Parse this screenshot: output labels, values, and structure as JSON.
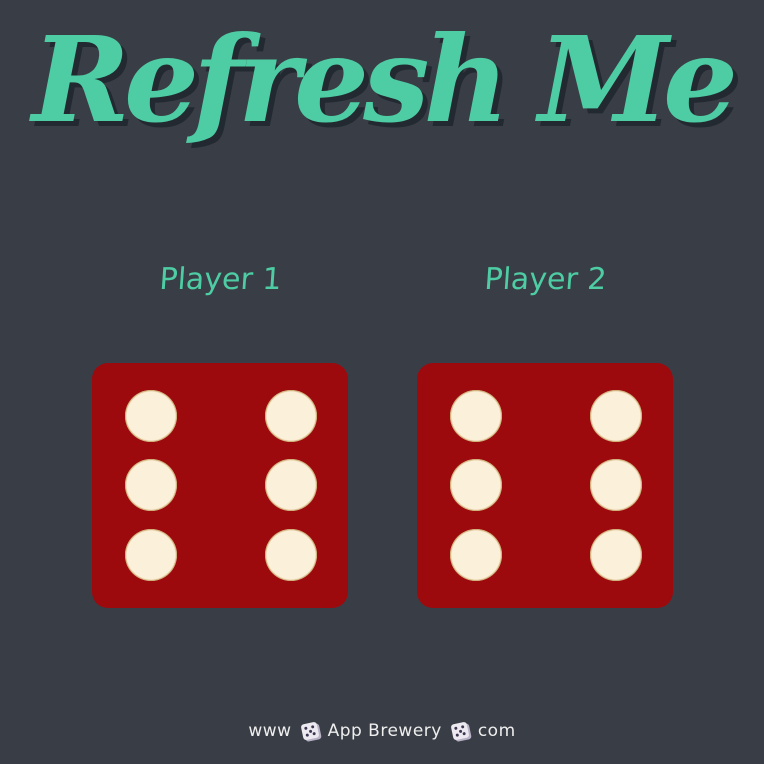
{
  "title": "Refresh Me",
  "players": [
    {
      "label": "Player 1",
      "die_value": 6
    },
    {
      "label": "Player 2",
      "die_value": 6
    }
  ],
  "footer": {
    "prefix": "www",
    "brand": "App Brewery",
    "suffix": "com",
    "icon": "dice-icon"
  },
  "colors": {
    "background": "#393E46",
    "accent": "#4ECCA3",
    "die": "#9C0A0E",
    "pip": "#FBF0D9",
    "footer_text": "#EEEEEE"
  }
}
